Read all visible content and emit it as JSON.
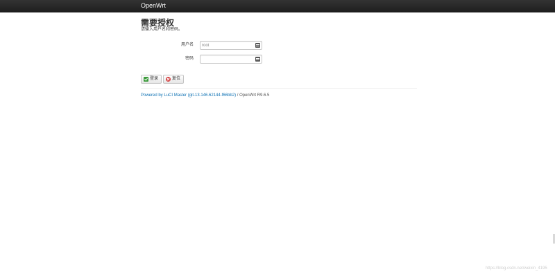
{
  "header": {
    "brand": "OpenWrt"
  },
  "page": {
    "title": "需要授权",
    "description": "请输入用户名和密码。"
  },
  "form": {
    "username_label": "用户名",
    "username_value": "root",
    "password_label": "密码",
    "password_value": ""
  },
  "buttons": {
    "login_label": "登录",
    "reset_label": "复位"
  },
  "footer": {
    "link_text": "Powered by LuCI Master (git-13.146.62144-f66bb2)",
    "suffix": " / OpenWrt R9.6.5"
  },
  "watermark": {
    "text": "https://blog.csdn.net/weixin_4195"
  }
}
